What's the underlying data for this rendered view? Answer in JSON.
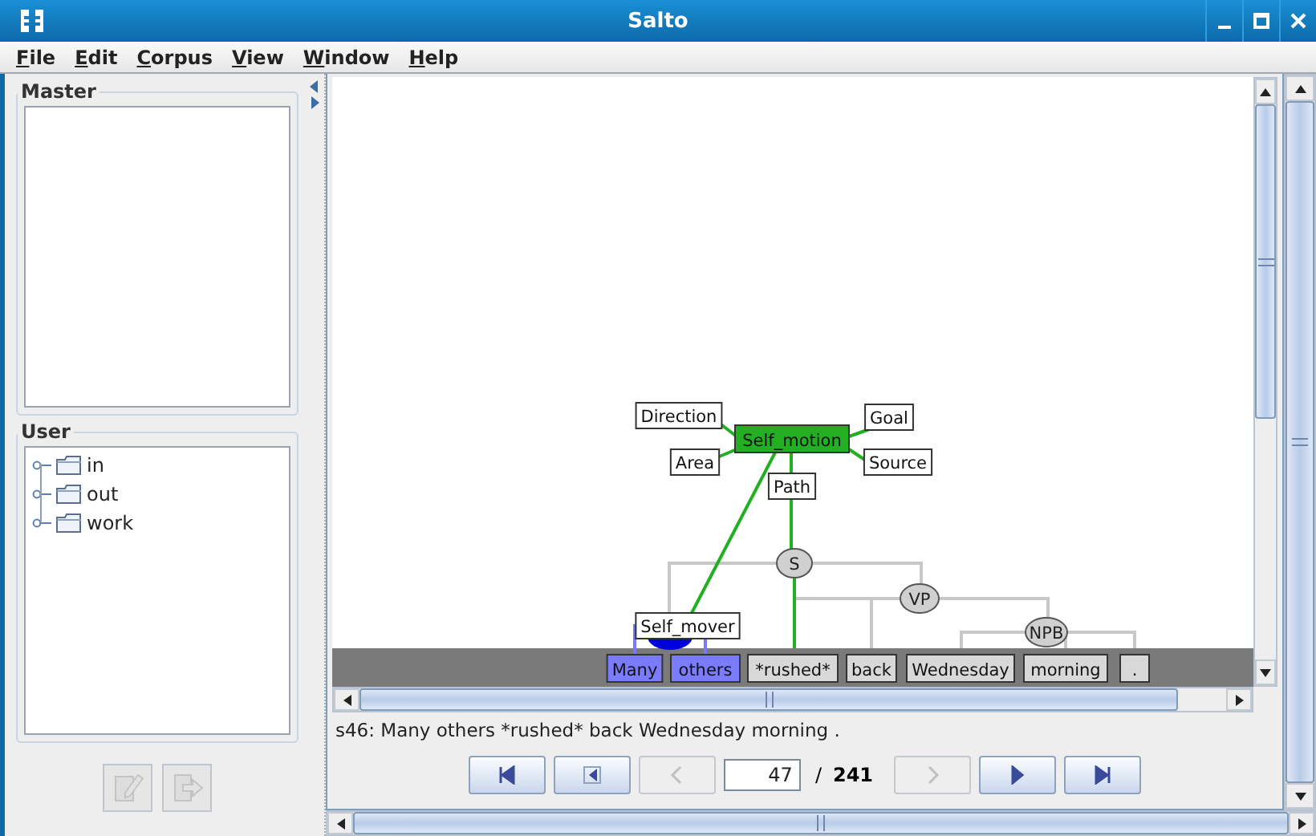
{
  "window": {
    "title": "Salto"
  },
  "menu": [
    {
      "label": "File"
    },
    {
      "label": "Edit"
    },
    {
      "label": "Corpus"
    },
    {
      "label": "View"
    },
    {
      "label": "Window"
    },
    {
      "label": "Help"
    }
  ],
  "master": {
    "title": "Master"
  },
  "user": {
    "title": "User",
    "tree": [
      {
        "label": "in",
        "expanded": false
      },
      {
        "label": "out",
        "expanded": false
      },
      {
        "label": "work",
        "expanded": false
      }
    ]
  },
  "side_buttons": [
    {
      "kind": "edit",
      "disabled": true
    },
    {
      "kind": "export",
      "disabled": true
    }
  ],
  "graph": {
    "frame": {
      "label": "Self_motion"
    },
    "frame_elements": [
      {
        "label": "Direction"
      },
      {
        "label": "Goal"
      },
      {
        "label": "Area"
      },
      {
        "label": "Source"
      },
      {
        "label": "Path"
      },
      {
        "label": "Self_mover"
      }
    ],
    "syntax_nodes": [
      {
        "label": "S"
      },
      {
        "label": "VP"
      },
      {
        "label": "NPB"
      }
    ],
    "tokens": [
      {
        "label": "Many",
        "highlighted": true
      },
      {
        "label": "others",
        "highlighted": true
      },
      {
        "label": "*rushed*",
        "highlighted": false
      },
      {
        "label": "back",
        "highlighted": false
      },
      {
        "label": "Wednesday",
        "highlighted": false
      },
      {
        "label": "morning",
        "highlighted": false
      },
      {
        "label": ".",
        "highlighted": false
      }
    ]
  },
  "sentence": "s46: Many others *rushed* back Wednesday morning .",
  "navigation": {
    "buttons_before": [
      {
        "kind": "first",
        "disabled": false
      },
      {
        "kind": "previous",
        "disabled": false
      },
      {
        "kind": "back",
        "disabled": true
      }
    ],
    "page": {
      "value": "47",
      "separator": "/",
      "total": "241"
    },
    "buttons_after": [
      {
        "kind": "forward",
        "disabled": true
      },
      {
        "kind": "next",
        "disabled": false
      },
      {
        "kind": "last",
        "disabled": false
      }
    ]
  }
}
